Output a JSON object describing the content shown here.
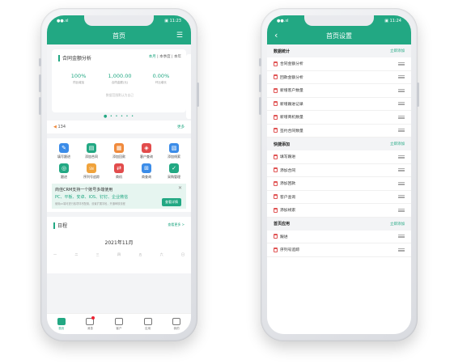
{
  "left": {
    "status": {
      "left": "●●.ııl",
      "right": "▣ 11:23"
    },
    "nav": {
      "title": "首页",
      "menu_icon": "menu-icon"
    },
    "analysis": {
      "title": "合同金额分析",
      "periods": [
        "本月",
        "本季度",
        "本年"
      ],
      "stats": [
        {
          "value": "100%",
          "label": "同比增加"
        },
        {
          "value": "1,000.00",
          "label": "合同金额(元)"
        },
        {
          "value": "0.00%",
          "label": "环比增长"
        }
      ],
      "footnote": "数据范围默认为自己"
    },
    "notice": {
      "text": "134",
      "more": "更多"
    },
    "grid": [
      {
        "label": "填写跟进",
        "color": "#3b8ce8",
        "glyph": "✎"
      },
      {
        "label": "添加合同",
        "color": "#22a883",
        "glyph": "▤"
      },
      {
        "label": "添加回款",
        "color": "#f08a3c",
        "glyph": "▦"
      },
      {
        "label": "客户查询",
        "color": "#e24c4c",
        "glyph": "◈"
      },
      {
        "label": "添加线索",
        "color": "#3b8ce8",
        "glyph": "▧"
      },
      {
        "label": "跟进",
        "color": "#22a883",
        "glyph": "◎"
      },
      {
        "label": "序列号追踪",
        "color": "#f0a33c",
        "glyph": "SN"
      },
      {
        "label": "商机",
        "color": "#e24c4c",
        "glyph": "⇄"
      },
      {
        "label": "商查询",
        "color": "#3b8ce8",
        "glyph": "⊞"
      },
      {
        "label": "采购管理",
        "color": "#22a883",
        "glyph": "✓"
      }
    ],
    "promo": {
      "title": "商佳CRM支持一个账号多端使用",
      "subtitle": "PC、平板、安卓、IOS、钉钉、企业微信",
      "note": "使用pc端可进行各项详尽配置，设置扩展字段，开通审核流程",
      "button": "查看详情"
    },
    "schedule": {
      "title": "日程",
      "more": "查看更多 >",
      "month": "2021年11月",
      "weekdays": [
        "一",
        "二",
        "三",
        "四",
        "五",
        "六",
        "日"
      ]
    },
    "tabs": [
      {
        "label": "首页",
        "icon": "home-icon",
        "active": true
      },
      {
        "label": "消息",
        "icon": "message-icon",
        "active": false
      },
      {
        "label": "客户",
        "icon": "customer-icon",
        "active": false
      },
      {
        "label": "应用",
        "icon": "apps-icon",
        "active": false
      },
      {
        "label": "我的",
        "icon": "profile-icon",
        "active": false
      }
    ]
  },
  "right": {
    "status": {
      "left": "●●.ııl",
      "right": "▣ 11:24"
    },
    "nav": {
      "title": "首页设置",
      "back_icon": "back-icon"
    },
    "sections": [
      {
        "title": "数据统计",
        "action": "立即添加",
        "items": [
          "合同金额分析",
          "回款金额分析",
          "新增客户数量",
          "新增跟进记录",
          "新增商机数量",
          "签约合同数量"
        ]
      },
      {
        "title": "快捷添加",
        "action": "立即添加",
        "items": [
          "填写跟进",
          "添加合同",
          "添加回款",
          "客户查询",
          "添加线索"
        ]
      },
      {
        "title": "首页应用",
        "action": "立即添加",
        "items": [
          "跟进",
          "序列号追踪"
        ]
      }
    ]
  }
}
